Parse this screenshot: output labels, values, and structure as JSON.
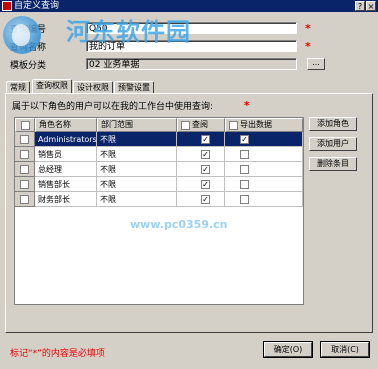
{
  "window": {
    "title": "自定义查询",
    "help_glyph": "?",
    "close_glyph": "×"
  },
  "watermark": {
    "text": "河东软件园",
    "url": "www.pc0359.cn"
  },
  "form": {
    "code_label": "查询编号",
    "code_value": "Q50",
    "name_label": "查询名称",
    "name_value": "我的订单",
    "module_label": "模板分类",
    "module_value": "02 业务单据",
    "required_mark": "*",
    "browse_label": "..."
  },
  "tabs": [
    {
      "label": "常规",
      "active": false
    },
    {
      "label": "查询权限",
      "active": true
    },
    {
      "label": "设计权限",
      "active": false
    },
    {
      "label": "预警设置",
      "active": false
    }
  ],
  "permissions": {
    "description": "属于以下角色的用户可以在我的工作台中使用查询:",
    "description_mark": "*",
    "columns": [
      "角色名称",
      "部门范围",
      "查阅",
      "导出数据"
    ],
    "rows": [
      {
        "role": "Administrators",
        "scope": "不限",
        "view": true,
        "export": true,
        "selected": true
      },
      {
        "role": "销售员",
        "scope": "不限",
        "view": true,
        "export": false,
        "selected": false
      },
      {
        "role": "总经理",
        "scope": "不限",
        "view": true,
        "export": false,
        "selected": false
      },
      {
        "role": "销售部长",
        "scope": "不限",
        "view": true,
        "export": false,
        "selected": false
      },
      {
        "role": "财务部长",
        "scope": "不限",
        "view": true,
        "export": false,
        "selected": false
      }
    ],
    "buttons": {
      "add_role": "添加角色",
      "add_user": "添加用户",
      "delete_item": "删除条目"
    }
  },
  "footer": {
    "note": "标记“*”的内容是必填项",
    "ok_label": "确定(O)",
    "cancel_label": "取消(C)"
  },
  "colors": {
    "titlebar": "#0a246a",
    "face": "#d4d0c8",
    "required": "#e00000",
    "selected_row": "#0a246a"
  }
}
